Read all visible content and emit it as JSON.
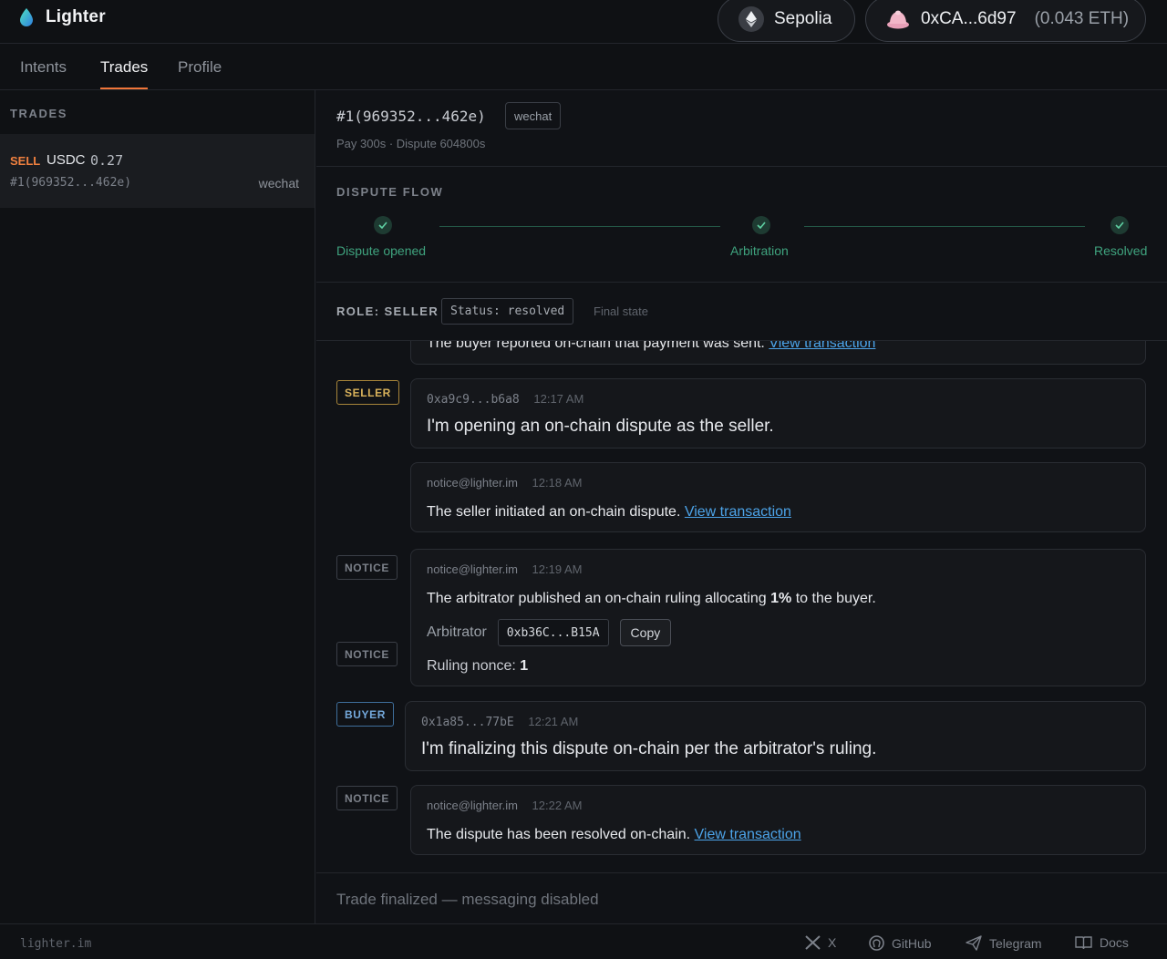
{
  "app": {
    "name": "Lighter"
  },
  "header": {
    "network": "Sepolia",
    "wallet": {
      "address": "0xCA...6d97",
      "balance": "(0.043 ETH)"
    }
  },
  "tabs": [
    {
      "label": "Intents",
      "active": false
    },
    {
      "label": "Trades",
      "active": true
    },
    {
      "label": "Profile",
      "active": false
    }
  ],
  "sidebar": {
    "title": "TRADES",
    "trades": [
      {
        "side": "SELL",
        "token": "USDC",
        "amount": "0.27",
        "id": "#1(969352...462e)",
        "method": "wechat"
      }
    ]
  },
  "trade": {
    "id": "#1(969352...462e)",
    "method": "wechat",
    "sub": "Pay 300s · Dispute 604800s"
  },
  "flow": {
    "title": "DISPUTE FLOW",
    "steps": [
      "Dispute opened",
      "Arbitration",
      "Resolved"
    ]
  },
  "role": {
    "label": "ROLE: SELLER",
    "status": "Status: resolved",
    "state": "Final state"
  },
  "messages": [
    {
      "text": "The buyer reported on-chain that payment was sent.",
      "link": "View transaction"
    },
    {
      "role": "SELLER",
      "from": "0xa9c9...b6a8",
      "time": "12:17 AM",
      "text": "I'm opening an on-chain dispute as the seller."
    },
    {
      "role": "NOTICE",
      "from": "notice@lighter.im",
      "time": "12:18 AM",
      "text": "The seller initiated an on-chain dispute.",
      "link": "View transaction"
    },
    {
      "role": "NOTICE",
      "from": "notice@lighter.im",
      "time": "12:19 AM",
      "text_before": "The arbitrator published an on-chain ruling allocating",
      "percent": "1%",
      "text_after": "to the buyer.",
      "arbitrator_label": "Arbitrator",
      "arbitrator_addr": "0xb36C...B15A",
      "copy_label": "Copy",
      "nonce_label": "Ruling nonce:",
      "nonce_value": "1"
    },
    {
      "role": "BUYER",
      "from": "0x1a85...77bE",
      "time": "12:21 AM",
      "text": "I'm finalizing this dispute on-chain per the arbitrator's ruling."
    },
    {
      "role": "NOTICE",
      "from": "notice@lighter.im",
      "time": "12:22 AM",
      "text": "The dispute has been resolved on-chain.",
      "link": "View transaction"
    }
  ],
  "composer": {
    "placeholder": "Trade finalized — messaging disabled"
  },
  "footer": {
    "domain": "lighter.im",
    "links": [
      "X",
      "GitHub",
      "Telegram",
      "Docs"
    ]
  },
  "colors": {
    "accent": "#f0763a",
    "success": "#3fa37e",
    "link": "#4ca3e8",
    "seller": "#d9b25b",
    "buyer": "#74a9dc"
  }
}
